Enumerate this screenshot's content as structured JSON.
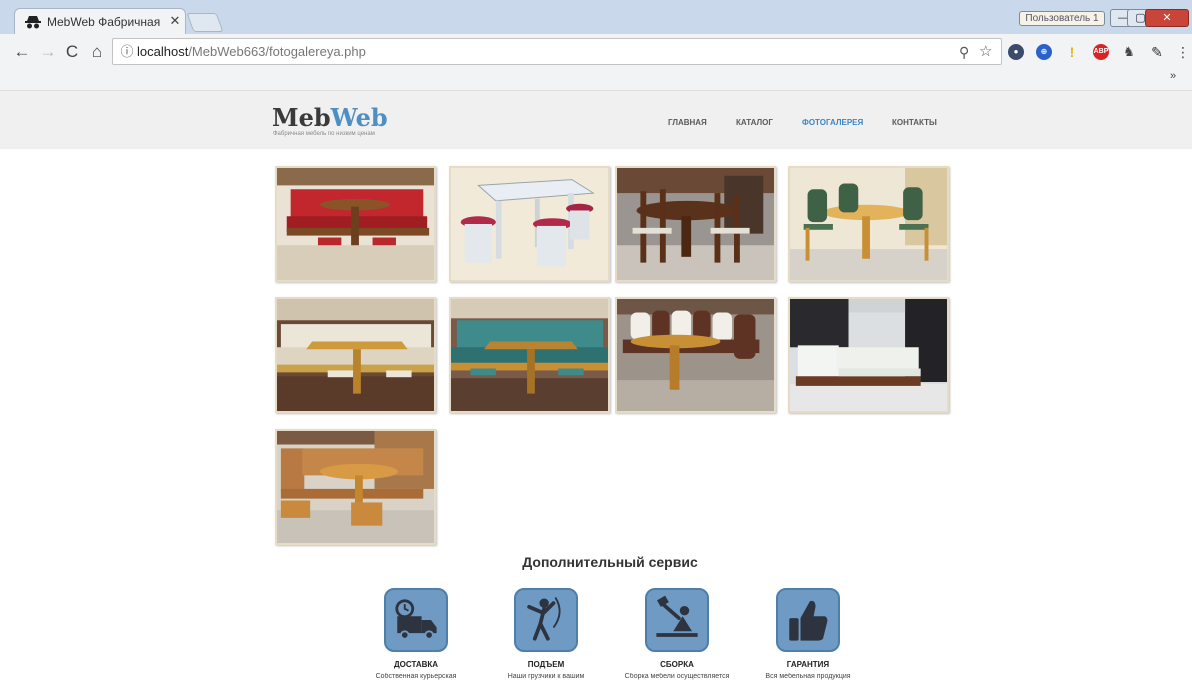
{
  "browser": {
    "tab_title": "MebWeb Фабричная Ме",
    "url_host": "localhost",
    "url_path": "/MebWeb663/fotogalereya.php",
    "user_label": "Пользователь 1",
    "close_glyph": "✕",
    "back_glyph": "←",
    "forward_glyph": "→",
    "reload_glyph": "C",
    "home_glyph": "⌂",
    "info_glyph": "ⓘ",
    "zoom_glyph": "⚲",
    "star_glyph": "☆",
    "menu_glyph": "⋮",
    "overflow_glyph": "»",
    "win_min_glyph": "—",
    "win_max_glyph": "▢",
    "win_close_glyph": "✕",
    "extensions": [
      "ext-1-icon",
      "ext-2-icon",
      "ext-3-icon",
      "ABP",
      "ext-5-icon",
      "ext-6-icon"
    ]
  },
  "site": {
    "logo_part1": "Meb",
    "logo_part2": "Web",
    "tagline": "Фабричная мебель по низким ценам",
    "nav": [
      "ГЛАВНАЯ",
      "КАТАЛОГ",
      "ФОТОГАЛЕРЕЯ",
      "КОНТАКТЫ"
    ],
    "active_nav": "ФОТОГАЛЕРЕЯ",
    "colors": {
      "logo_dark": "#3a3a3a",
      "logo_accent": "#4e8fc3",
      "nav_active": "#3c86c4",
      "service_icon": "#6f9ac4"
    }
  },
  "gallery": {
    "items": [
      "red-corner-sofa-with-table",
      "white-table-with-red-stools",
      "dark-wood-table-with-chairs",
      "light-wood-table-with-green-chairs",
      "beige-corner-sofa-with-table",
      "teal-corner-sofa-with-table",
      "brown-white-corner-sofa-with-table",
      "white-corner-sofa-in-kitchen",
      "orange-corner-sofa-with-table-and-stools"
    ]
  },
  "service": {
    "title": "Дополнительный сервис",
    "items": [
      {
        "icon": "delivery-truck-icon",
        "label": "ДОСТАВКА",
        "desc": "Собственная курьерская"
      },
      {
        "icon": "lifting-mover-icon",
        "label": "ПОДЪЕМ",
        "desc": "Наши грузчики к вашим"
      },
      {
        "icon": "assembly-worker-icon",
        "label": "СБОРКА",
        "desc": "Сборка мебели осуществляется"
      },
      {
        "icon": "thumbs-up-icon",
        "label": "ГАРАНТИЯ",
        "desc": "Вся мебельная продукция"
      }
    ]
  }
}
